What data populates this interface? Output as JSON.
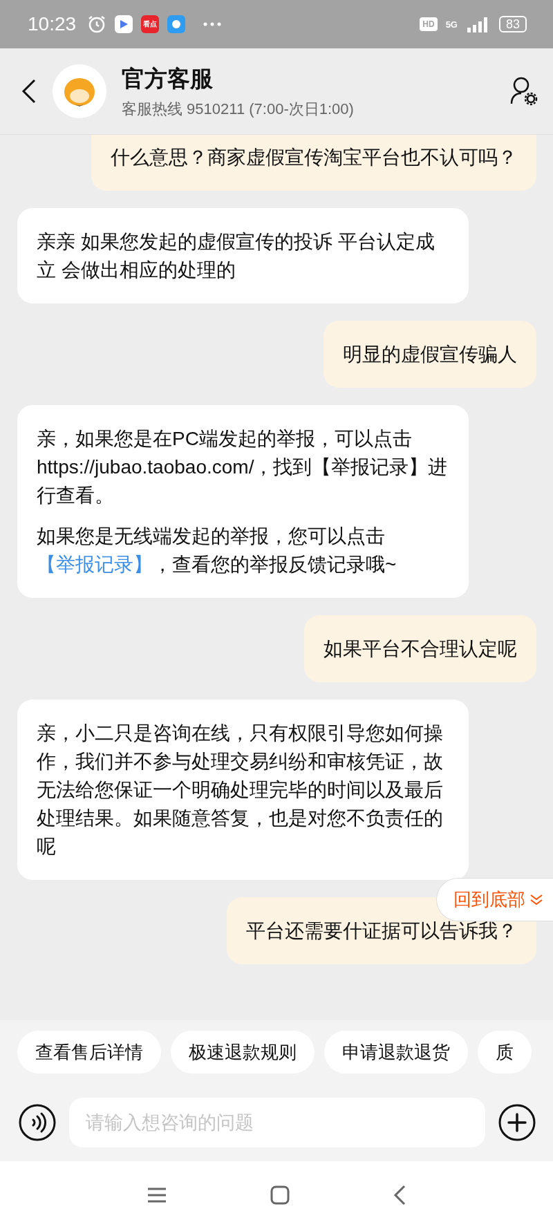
{
  "status_bar": {
    "time": "10:23",
    "app_badge": "看点",
    "hd": "HD",
    "network": "5G",
    "battery": "83"
  },
  "header": {
    "title": "官方客服",
    "subtitle": "客服热线 9510211 (7:00-次日1:00)"
  },
  "messages": [
    {
      "kind": "user",
      "cut_top": true,
      "paragraphs": [
        [
          {
            "kind": "text",
            "text": "什么意思？商家虚假宣传淘宝平台也不认可吗？"
          }
        ]
      ]
    },
    {
      "kind": "agent",
      "cut_top": false,
      "paragraphs": [
        [
          {
            "kind": "text",
            "text": "亲亲 如果您发起的虚假宣传的投诉 平台认定成立 会做出相应的处理的"
          }
        ]
      ]
    },
    {
      "kind": "user",
      "cut_top": false,
      "paragraphs": [
        [
          {
            "kind": "text",
            "text": "明显的虚假宣传骗人"
          }
        ]
      ]
    },
    {
      "kind": "agent",
      "cut_top": false,
      "paragraphs": [
        [
          {
            "kind": "text",
            "text": "亲，如果您是在PC端发起的举报，可以点击https://jubao.taobao.com/，找到【举报记录】进行查看。"
          }
        ],
        [
          {
            "kind": "text",
            "text": "如果您是无线端发起的举报，您可以点击"
          },
          {
            "kind": "link",
            "text": "【举报记录】"
          },
          {
            "kind": "text",
            "text": "，查看您的举报反馈记录哦~"
          }
        ]
      ]
    },
    {
      "kind": "user",
      "cut_top": false,
      "paragraphs": [
        [
          {
            "kind": "text",
            "text": "如果平台不合理认定呢"
          }
        ]
      ]
    },
    {
      "kind": "agent",
      "cut_top": false,
      "paragraphs": [
        [
          {
            "kind": "text",
            "text": "亲，小二只是咨询在线，只有权限引导您如何操作，我们并不参与处理交易纠纷和审核凭证，故无法给您保证一个明确处理完毕的时间以及最后处理结果。如果随意答复，也是对您不负责任的呢"
          }
        ]
      ]
    },
    {
      "kind": "user",
      "cut_top": false,
      "paragraphs": [
        [
          {
            "kind": "text",
            "text": "平台还需要什证据可以告诉我？"
          }
        ]
      ]
    }
  ],
  "scroll_to_bottom": {
    "label": "回到底部"
  },
  "quick_replies": [
    "查看售后详情",
    "极速退款规则",
    "申请退款退货",
    "质"
  ],
  "input": {
    "placeholder": "请输入想咨询的问题"
  }
}
